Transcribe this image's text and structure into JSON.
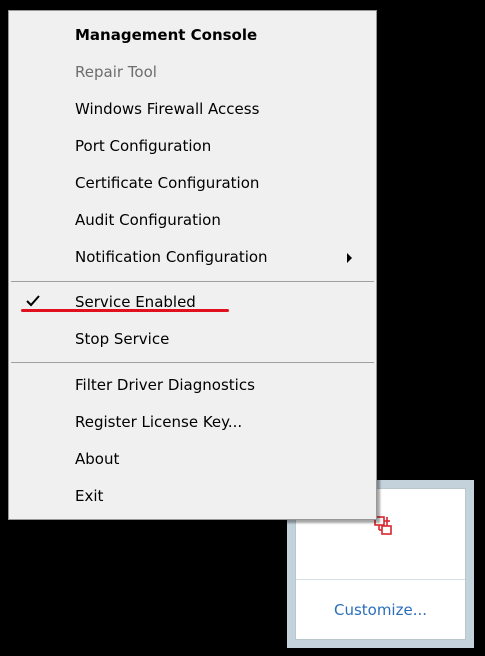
{
  "context_menu": {
    "items": [
      {
        "label": "Management Console",
        "style": "bold"
      },
      {
        "label": "Repair Tool",
        "style": "disabled"
      },
      {
        "label": "Windows Firewall Access",
        "style": "normal"
      },
      {
        "label": "Port Configuration",
        "style": "normal"
      },
      {
        "label": "Certificate Configuration",
        "style": "normal"
      },
      {
        "label": "Audit Configuration",
        "style": "normal"
      },
      {
        "label": "Notification Configuration",
        "style": "normal",
        "has_submenu": true
      },
      {
        "label": "Service Enabled",
        "style": "normal",
        "checked": true
      },
      {
        "label": "Stop Service",
        "style": "normal"
      },
      {
        "label": "Filter Driver Diagnostics",
        "style": "normal"
      },
      {
        "label": "Register License Key...",
        "style": "normal"
      },
      {
        "label": "About",
        "style": "normal"
      },
      {
        "label": "Exit",
        "style": "normal"
      }
    ]
  },
  "tray_flyout": {
    "app_icon": "red-shield-network-icon",
    "customize_label": "Customize..."
  },
  "colors": {
    "menu_background": "#f0f0f0",
    "highlight_underline": "#e0101e",
    "link": "#2a6ebb",
    "desktop": "#000000",
    "flyout_frame": "#c3d2db"
  }
}
